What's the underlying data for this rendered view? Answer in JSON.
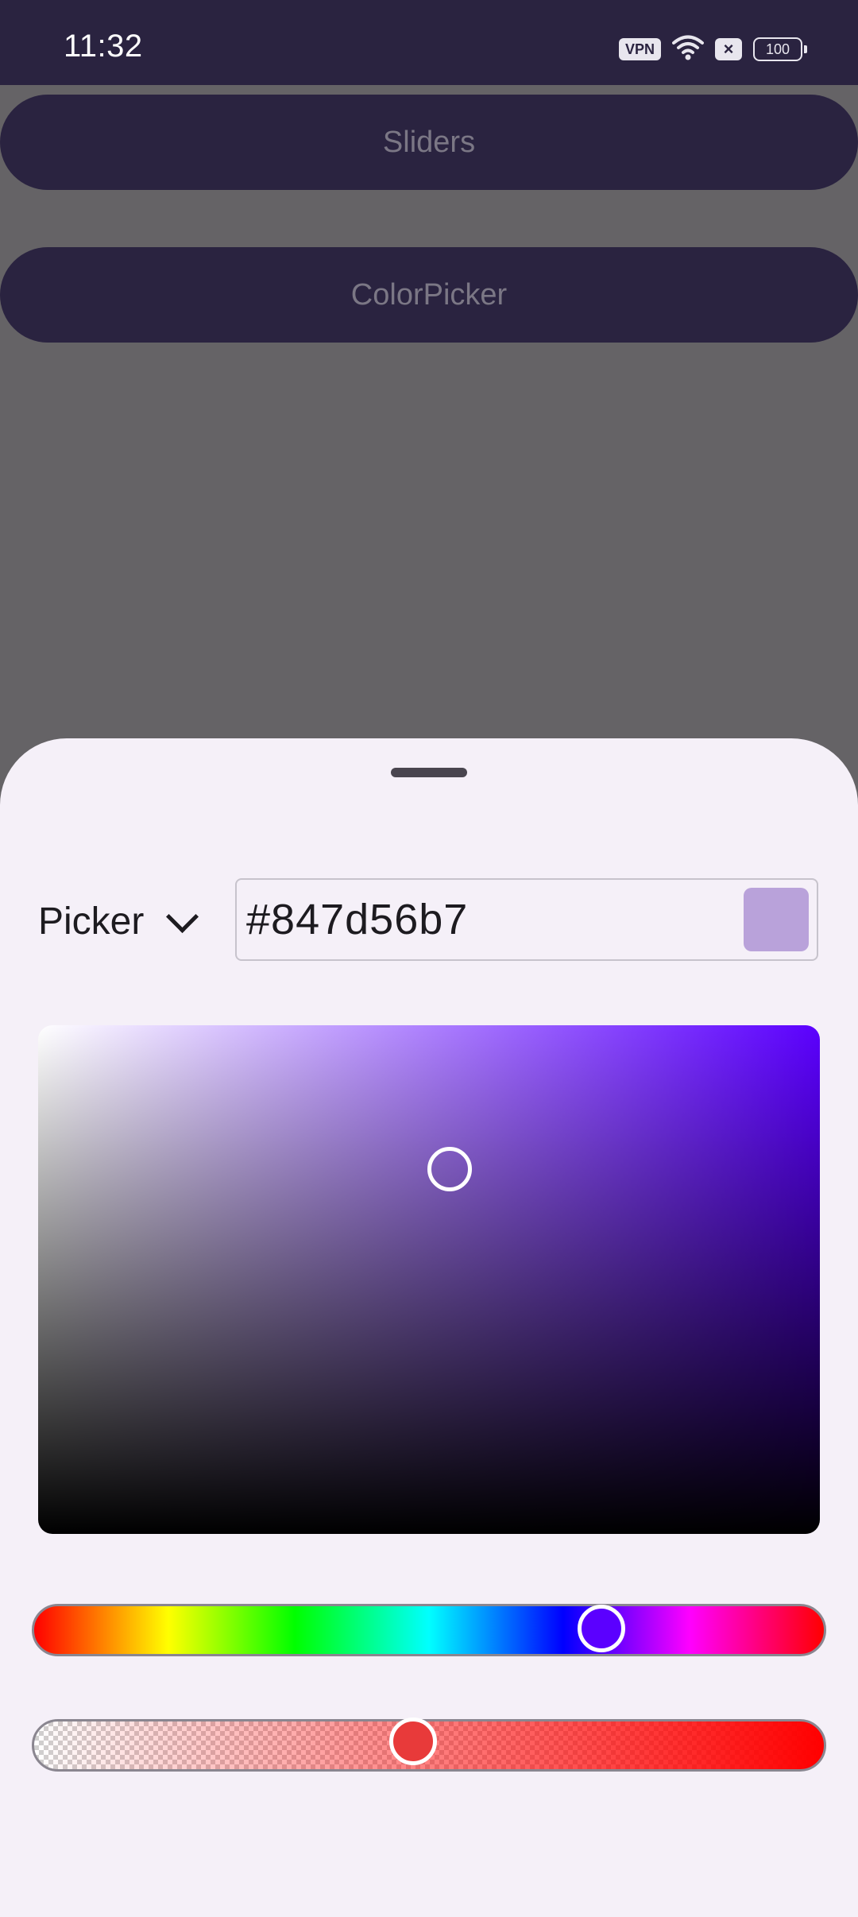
{
  "status_bar": {
    "time": "11:32",
    "vpn_label": "VPN",
    "battery_level": "100",
    "icons": [
      "vpn-icon",
      "wifi-icon",
      "no-sim-icon",
      "battery-icon"
    ]
  },
  "background_buttons": {
    "sliders_label": "Sliders",
    "colorpicker_label": "ColorPicker"
  },
  "sheet": {
    "mode_label": "Picker",
    "hex_value": "#847d56b7",
    "swatch_color": "#b9a2da",
    "hue_color": "#5b00ff"
  },
  "colors": {
    "app_bar": "#2a2340",
    "sheet_background": "#f5f0f8",
    "scrim": "#656366"
  }
}
